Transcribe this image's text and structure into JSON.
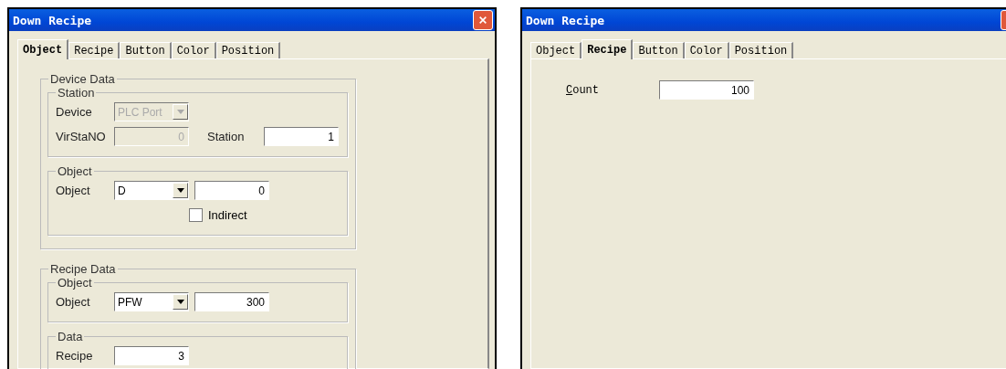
{
  "dialogs": [
    {
      "title": "Down Recipe",
      "tabs": [
        {
          "label": "Object",
          "selected": true
        },
        {
          "label": "Recipe",
          "selected": false
        },
        {
          "label": "Button",
          "selected": false
        },
        {
          "label": "Color",
          "selected": false
        },
        {
          "label": "Position",
          "selected": false
        }
      ],
      "page": {
        "kind": "groups",
        "groups": [
          {
            "title": "Device Data",
            "groups": [
              {
                "title": "Station",
                "rows": [
                  [
                    {
                      "kind": "label",
                      "text": "Device"
                    },
                    {
                      "kind": "combo",
                      "value": "PLC Port",
                      "disabled": true
                    }
                  ],
                  [
                    {
                      "kind": "label",
                      "text": "VirStaNO"
                    },
                    {
                      "kind": "field",
                      "value": "0",
                      "disabled": true
                    },
                    {
                      "kind": "label",
                      "text": "Station"
                    },
                    {
                      "kind": "field",
                      "value": "1",
                      "disabled": false
                    }
                  ]
                ]
              },
              {
                "title": "Object",
                "rows": [
                  [
                    {
                      "kind": "label",
                      "text": "Object"
                    },
                    {
                      "kind": "combo",
                      "value": "D",
                      "disabled": false
                    },
                    {
                      "kind": "field",
                      "value": "0",
                      "disabled": false
                    }
                  ],
                  [
                    {
                      "kind": "spacer"
                    },
                    {
                      "kind": "checkbox",
                      "text": "Indirect",
                      "checked": false
                    }
                  ]
                ]
              }
            ]
          },
          {
            "title": "Recipe Data",
            "groups": [
              {
                "title": "Object",
                "rows": [
                  [
                    {
                      "kind": "label",
                      "text": "Object"
                    },
                    {
                      "kind": "combo",
                      "value": "PFW",
                      "disabled": false
                    },
                    {
                      "kind": "field",
                      "value": "300",
                      "disabled": false
                    }
                  ]
                ]
              },
              {
                "title": "Data",
                "rows": [
                  [
                    {
                      "kind": "label",
                      "text": "Recipe"
                    },
                    {
                      "kind": "field",
                      "value": "3",
                      "disabled": false
                    }
                  ]
                ]
              }
            ]
          }
        ]
      }
    },
    {
      "title": "Down Recipe",
      "tabs": [
        {
          "label": "Object",
          "selected": false
        },
        {
          "label": "Recipe",
          "selected": true
        },
        {
          "label": "Button",
          "selected": false
        },
        {
          "label": "Color",
          "selected": false
        },
        {
          "label": "Position",
          "selected": false
        }
      ],
      "page": {
        "kind": "fields",
        "rows": [
          {
            "label": "Count",
            "value": "100"
          }
        ]
      }
    }
  ]
}
